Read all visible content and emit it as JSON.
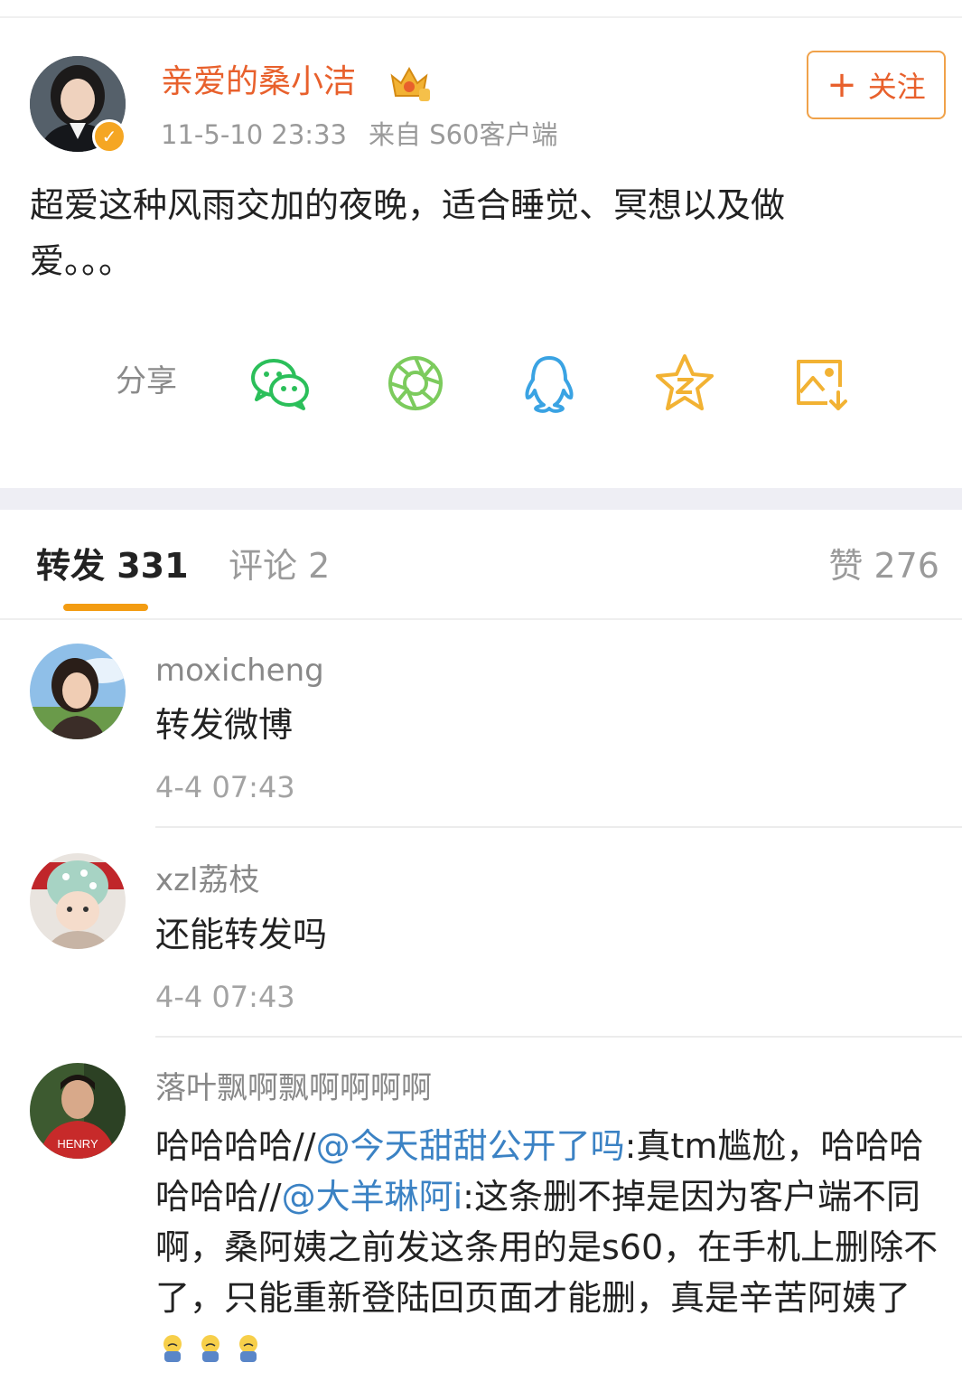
{
  "post": {
    "author": "亲爱的桑小洁",
    "timestamp": "11-5-10 23:33",
    "source": "来自 S60客户端",
    "follow_label": "关注",
    "content_line1": "超爱这种风雨交加的夜晚，适合睡觉、冥想以及做",
    "content_line2": "爱。。。",
    "share_label": "分享",
    "share_icons": [
      "wechat-icon",
      "moments-icon",
      "qq-icon",
      "qzone-icon",
      "save-image-icon"
    ],
    "accent_color": "#e8602c"
  },
  "tabs": {
    "forward": "转发 331",
    "comment": "评论 2",
    "like": "赞 276"
  },
  "comments": [
    {
      "user": "moxicheng",
      "text": "转发微博",
      "time": "4-4 07:43"
    },
    {
      "user": "xzl荔枝",
      "text": "还能转发吗",
      "time": "4-4 07:43"
    },
    {
      "user": "落叶飘啊飘啊啊啊啊",
      "text_parts": {
        "p1": "哈哈哈哈//",
        "m1": "@今天甜甜公开了吗",
        "p2": ":真tm尴尬，哈哈哈哈哈哈//",
        "m2": "@大羊琳阿i",
        "p3": ":这条删不掉是因为客户端不同啊，桑阿姨之前发这条用的是s60，在手机上删除不了，只能重新登陆回页面才能删，真是辛苦阿姨了"
      }
    }
  ]
}
